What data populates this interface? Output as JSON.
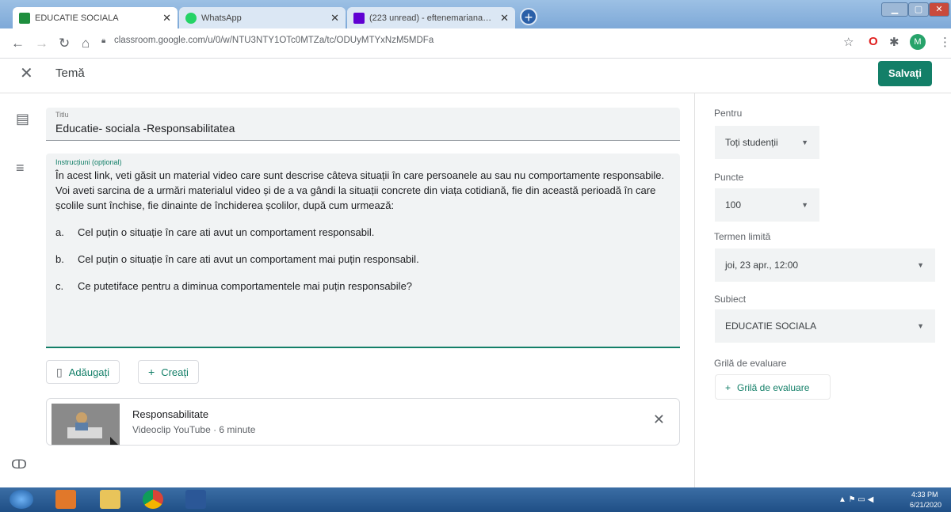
{
  "browser": {
    "tabs": [
      {
        "title": "EDUCATIE SOCIALA",
        "favicon_color": "#1e8e3e"
      },
      {
        "title": "WhatsApp",
        "favicon_color": "#25d366"
      },
      {
        "title": "(223 unread) - eftenemariana@y",
        "favicon_color": "#6001d2"
      }
    ],
    "new_tab": "+",
    "url": "classroom.google.com/u/0/w/NTU3NTY1OTc0MTZa/tc/ODUyMTYxNzM5MDFa",
    "profile_initial": "M"
  },
  "header": {
    "title": "Temă",
    "save_label": "Salvați"
  },
  "form": {
    "title_label": "Titlu",
    "title_value": "Educatie- sociala -Responsabilitatea",
    "instructions_label": "Instrucțiuni (opțional)",
    "instructions_lines": [
      "În acest link, veti găsit un material video care sunt descrise câteva situații în care persoanele au sau nu comportamente responsabile.",
      "Voi aveti sarcina de a urmări materialul video și de a va gândi la situații concrete din viața cotidiană, fie din această perioadă în care școlile sunt închise, fie dinainte de închiderea școlilor, după cum urmează:"
    ],
    "instructions_list": [
      {
        "marker": "a.",
        "text": "Cel puțin o situație în care ati avut un comportament responsabil."
      },
      {
        "marker": "b.",
        "text": "Cel puțin o situație în care ati avut un comportament mai puțin responsabil."
      },
      {
        "marker": "c.",
        "text": "Ce putetiface pentru a diminua comportamentele mai puțin responsabile?"
      }
    ],
    "add_label": "Adăugați",
    "create_label": "Creați"
  },
  "attachment": {
    "title": "Responsabilitate",
    "subtitle": "Videoclip YouTube · 6 minute"
  },
  "sidebar": {
    "for_label": "Pentru",
    "for_value": "Toți studenții",
    "points_label": "Puncte",
    "points_value": "100",
    "due_label": "Termen limită",
    "due_value": "joi, 23 apr., 12:00",
    "topic_label": "Subiect",
    "topic_value": "EDUCATIE SOCIALA",
    "rubric_label": "Grilă de evaluare",
    "rubric_button": "Grilă de evaluare"
  },
  "taskbar": {
    "time": "4:33 PM",
    "date": "6/21/2020"
  },
  "colors": {
    "accent": "#137f68",
    "field_bg": "#f1f3f4"
  }
}
